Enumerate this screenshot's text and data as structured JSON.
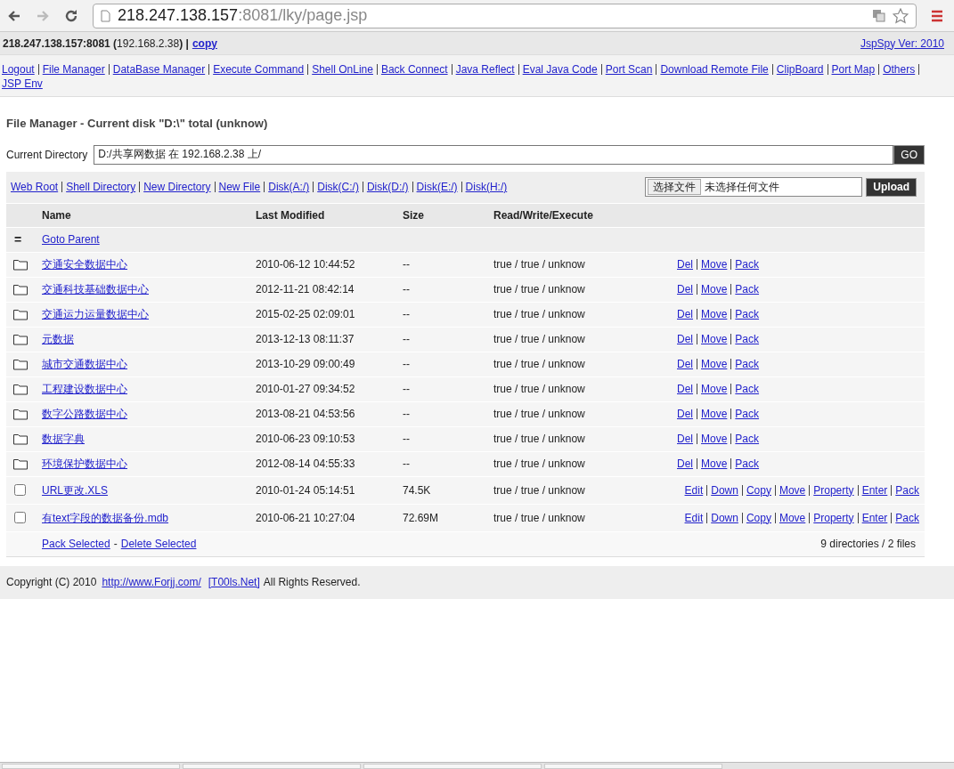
{
  "browser": {
    "url_host": "218.247.138.157",
    "url_rest": ":8081/lky/page.jsp"
  },
  "info_bar": {
    "text": "**218.247.138.157:8081 (**192.168.2.38**) |**",
    "copy_link": "copy",
    "version_link": "JspSpy Ver: 2010"
  },
  "nav": [
    "Logout",
    "File Manager",
    "DataBase Manager",
    "Execute Command",
    "Shell OnLine",
    "Back Connect",
    "Java Reflect",
    "Eval Java Code",
    "Port Scan",
    "Download Remote File",
    "ClipBoard",
    "Port Map",
    "Others",
    "JSP Env"
  ],
  "title": "File Manager - Current disk \"D:\\\" total (unknow)",
  "directory": {
    "label": "Current Directory",
    "value": "D:/共享网数据 在 192.168.2.38 上/",
    "button": "GO"
  },
  "toolbar_links": [
    "Web Root",
    "Shell Directory",
    "New Directory",
    "New File",
    "Disk(A:/)",
    "Disk(C:/)",
    "Disk(D:/)",
    "Disk(E:/)",
    "Disk(H:/)"
  ],
  "upload": {
    "choose_button": "选择文件",
    "file_status": "未选择任何文件",
    "button": "Upload"
  },
  "table": {
    "columns": [
      "Name",
      "Last Modified",
      "Size",
      "Read/Write/Execute"
    ],
    "parent": {
      "icon_text": "=",
      "label": "Goto Parent"
    },
    "rows": [
      {
        "kind": "dir",
        "name": "交通安全数据中心",
        "modified": "2010-06-12 10:44:52",
        "size": "--",
        "rwx": "true / true / unknow",
        "actions": [
          "Del",
          "Move",
          "Pack"
        ]
      },
      {
        "kind": "dir",
        "name": "交通科技基础数据中心",
        "modified": "2012-11-21 08:42:14",
        "size": "--",
        "rwx": "true / true / unknow",
        "actions": [
          "Del",
          "Move",
          "Pack"
        ]
      },
      {
        "kind": "dir",
        "name": "交通运力运量数据中心",
        "modified": "2015-02-25 02:09:01",
        "size": "--",
        "rwx": "true / true / unknow",
        "actions": [
          "Del",
          "Move",
          "Pack"
        ]
      },
      {
        "kind": "dir",
        "name": "元数据",
        "modified": "2013-12-13 08:11:37",
        "size": "--",
        "rwx": "true / true / unknow",
        "actions": [
          "Del",
          "Move",
          "Pack"
        ]
      },
      {
        "kind": "dir",
        "name": "城市交通数据中心",
        "modified": "2013-10-29 09:00:49",
        "size": "--",
        "rwx": "true / true / unknow",
        "actions": [
          "Del",
          "Move",
          "Pack"
        ]
      },
      {
        "kind": "dir",
        "name": "工程建设数据中心",
        "modified": "2010-01-27 09:34:52",
        "size": "--",
        "rwx": "true / true / unknow",
        "actions": [
          "Del",
          "Move",
          "Pack"
        ]
      },
      {
        "kind": "dir",
        "name": "数字公路数据中心",
        "modified": "2013-08-21 04:53:56",
        "size": "--",
        "rwx": "true / true / unknow",
        "actions": [
          "Del",
          "Move",
          "Pack"
        ]
      },
      {
        "kind": "dir",
        "name": "数据字典",
        "modified": "2010-06-23 09:10:53",
        "size": "--",
        "rwx": "true / true / unknow",
        "actions": [
          "Del",
          "Move",
          "Pack"
        ]
      },
      {
        "kind": "dir",
        "name": "环境保护数据中心",
        "modified": "2012-08-14 04:55:33",
        "size": "--",
        "rwx": "true / true / unknow",
        "actions": [
          "Del",
          "Move",
          "Pack"
        ]
      },
      {
        "kind": "file",
        "checked": false,
        "name": "URL更改.XLS",
        "modified": "2010-01-24 05:14:51",
        "size": "74.5K",
        "rwx": "true / true / unknow",
        "actions": [
          "Edit",
          "Down",
          "Copy",
          "Move",
          "Property",
          "Enter",
          "Pack"
        ]
      },
      {
        "kind": "file",
        "checked": false,
        "name": "有text字段的数据备份.mdb",
        "modified": "2010-06-21 10:27:04",
        "size": "72.69M",
        "rwx": "true / true / unknow",
        "actions": [
          "Edit",
          "Down",
          "Copy",
          "Move",
          "Property",
          "Enter",
          "Pack"
        ]
      }
    ],
    "footer": {
      "pack_link": "Pack Selected",
      "dash": "-",
      "delete_link": "Delete Selected",
      "summary": "9 directories / 2 files"
    }
  },
  "copyright": {
    "before": "Copyright (C) 2010",
    "link1": "http://www.Forjj.com/",
    "link2": "[T00ls.Net]",
    "after": "All Rights Reserved."
  }
}
